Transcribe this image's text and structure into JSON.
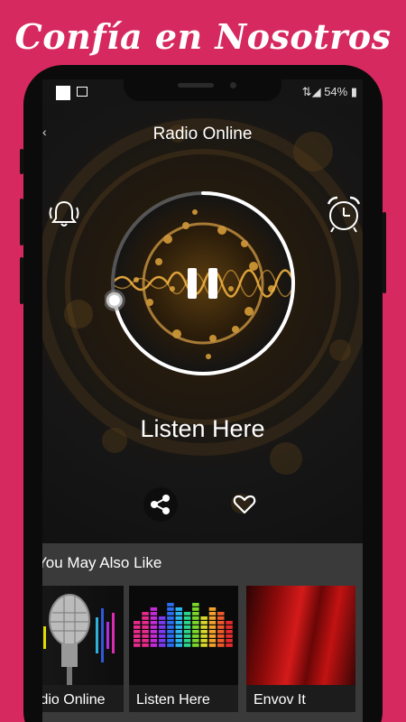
{
  "promo": {
    "headline": "Confía en Nosotros"
  },
  "status_bar": {
    "battery": "54%",
    "signal": "⇅◢"
  },
  "player": {
    "title": "Radio Online",
    "station_name": "Listen Here",
    "progress": 0.72,
    "state": "playing"
  },
  "icons": {
    "bell": "bell-ring-icon",
    "alarm": "alarm-clock-icon",
    "pause": "pause-icon",
    "share": "share-icon",
    "heart": "heart-icon"
  },
  "more": {
    "title": "You May Also Like",
    "items": [
      {
        "label": "Radio Online"
      },
      {
        "label": "Listen Here"
      },
      {
        "label": "Envov It"
      }
    ]
  },
  "colors": {
    "promo_bg": "#d6295f",
    "accent_gold": "#d89a2a",
    "panel": "#3a3a3a"
  }
}
